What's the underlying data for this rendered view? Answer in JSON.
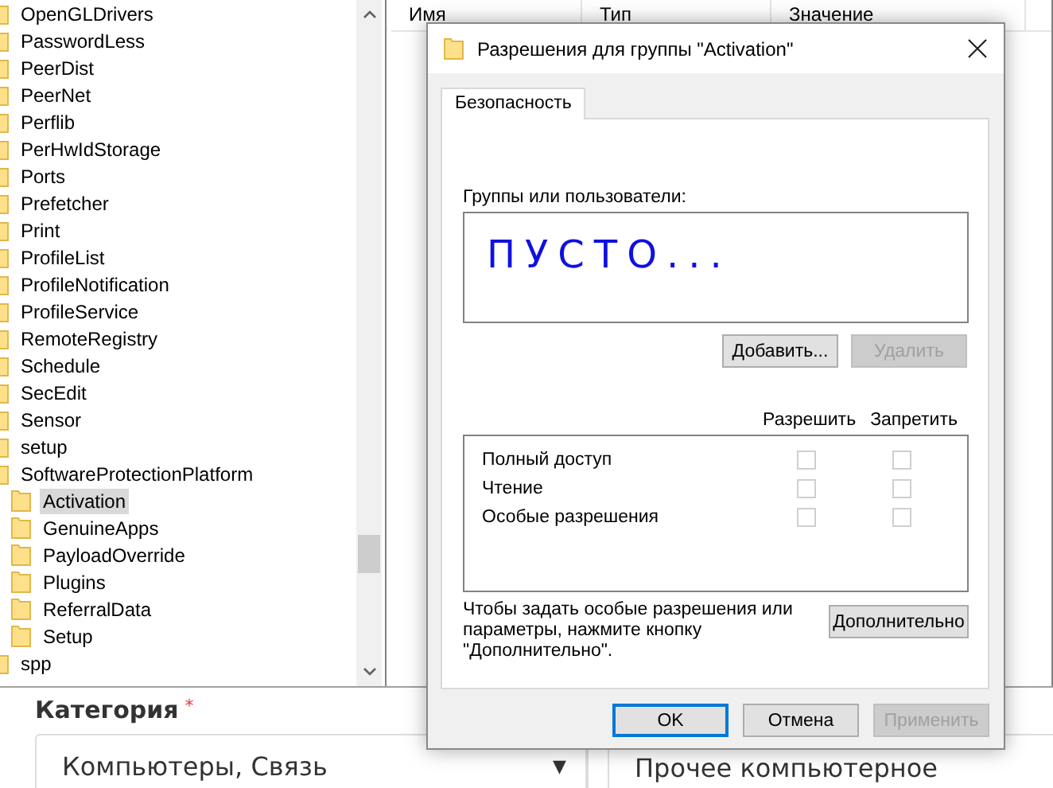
{
  "registry": {
    "tree": [
      {
        "label": "OpenGLDrivers",
        "selected": false
      },
      {
        "label": "PasswordLess",
        "selected": false
      },
      {
        "label": "PeerDist",
        "selected": false
      },
      {
        "label": "PeerNet",
        "selected": false
      },
      {
        "label": "Perflib",
        "selected": false
      },
      {
        "label": "PerHwIdStorage",
        "selected": false
      },
      {
        "label": "Ports",
        "selected": false
      },
      {
        "label": "Prefetcher",
        "selected": false
      },
      {
        "label": "Print",
        "selected": false
      },
      {
        "label": "ProfileList",
        "selected": false
      },
      {
        "label": "ProfileNotification",
        "selected": false
      },
      {
        "label": "ProfileService",
        "selected": false
      },
      {
        "label": "RemoteRegistry",
        "selected": false
      },
      {
        "label": "Schedule",
        "selected": false
      },
      {
        "label": "SecEdit",
        "selected": false
      },
      {
        "label": "Sensor",
        "selected": false
      },
      {
        "label": "setup",
        "selected": false
      },
      {
        "label": "SoftwareProtectionPlatform",
        "selected": false,
        "children": [
          {
            "label": "Activation",
            "selected": true
          },
          {
            "label": "GenuineApps",
            "selected": false
          },
          {
            "label": "PayloadOverride",
            "selected": false
          },
          {
            "label": "Plugins",
            "selected": false
          },
          {
            "label": "ReferralData",
            "selected": false
          },
          {
            "label": "Setup",
            "selected": false
          }
        ]
      },
      {
        "label": "spp",
        "selected": false
      }
    ],
    "columns": [
      "Имя",
      "Тип",
      "Значение"
    ]
  },
  "dialog": {
    "title": "Разрешения для группы \"Activation\"",
    "tabs": [
      {
        "label": "Безопасность",
        "selected": true
      }
    ],
    "groups_label": "Группы или пользователи:",
    "groups_list": [
      "ПУСТО..."
    ],
    "list_buttons": [
      {
        "label": "Добавить...",
        "disabled": false
      },
      {
        "label": "Удалить",
        "disabled": true
      }
    ],
    "permission_headers": [
      "Разрешить",
      "Запретить"
    ],
    "permissions": [
      {
        "name": "Полный доступ",
        "allow": false,
        "deny": false
      },
      {
        "name": "Чтение",
        "allow": false,
        "deny": false
      },
      {
        "name": "Особые разрешения",
        "allow": false,
        "deny": false
      }
    ],
    "advanced_note": "Чтобы задать особые разрешения или параметры, нажмите кнопку \"Дополнительно\".",
    "advanced_button": "Дополнительно",
    "footer_buttons": [
      {
        "label": "OK",
        "default": true,
        "disabled": false
      },
      {
        "label": "Отмена",
        "default": false,
        "disabled": false
      },
      {
        "label": "Применить",
        "default": false,
        "disabled": true
      }
    ]
  },
  "form": {
    "label": "Категория",
    "required_mark": "*",
    "category": {
      "value": "Компьютеры, Связь",
      "caret": "▼"
    },
    "subcategory": {
      "value": "Прочее компьютерное"
    }
  }
}
